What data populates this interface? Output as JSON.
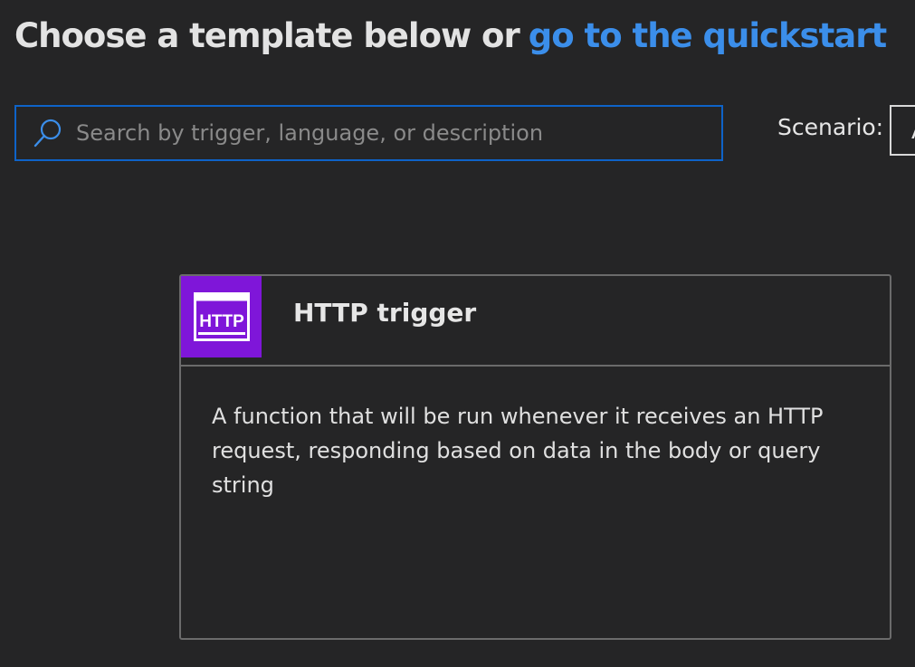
{
  "header": {
    "title_lead": "Choose a template below or",
    "title_link": "go to the quickstart"
  },
  "search": {
    "placeholder": "Search by trigger, language, or description",
    "value": "",
    "icon": "search-icon"
  },
  "scenario": {
    "label": "Scenario:",
    "selected_visible": "A"
  },
  "templates": [
    {
      "icon": "http-icon",
      "icon_text": "HTTP",
      "icon_color": "#7f16d9",
      "title": "HTTP trigger",
      "description": "A function that will be run whenever it receives an HTTP request, responding based on data in the body or query string"
    }
  ],
  "colors": {
    "background": "#252526",
    "link": "#3b8eea",
    "search_border": "#0e63c8",
    "card_border": "#6b6b6b"
  }
}
